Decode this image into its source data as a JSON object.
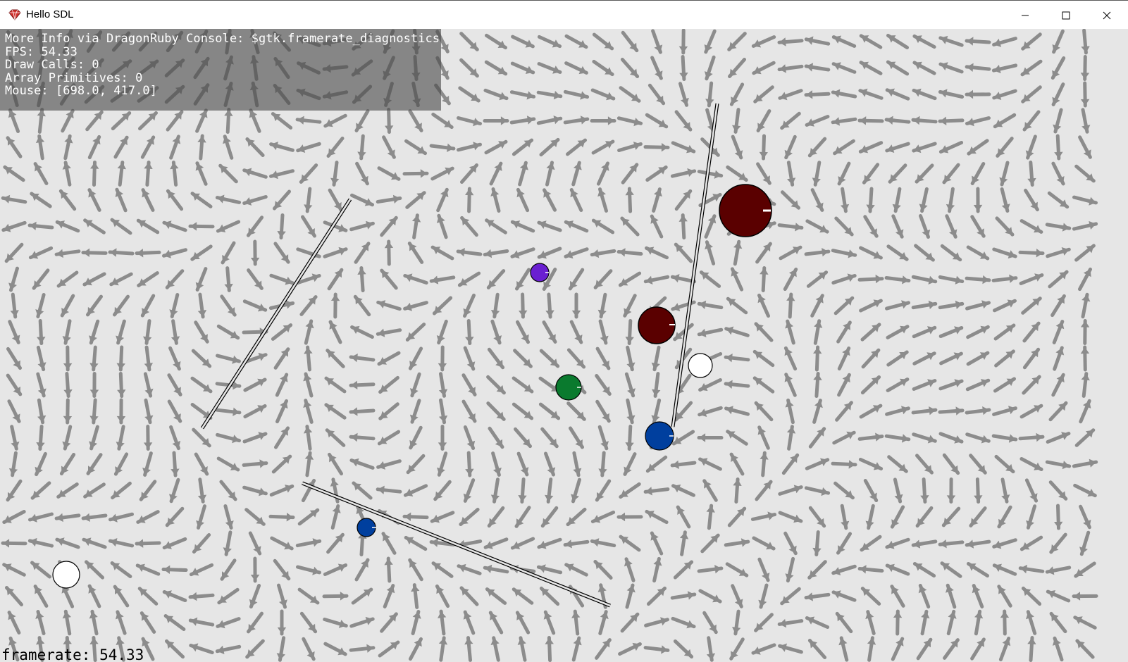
{
  "window": {
    "title": "Hello SDL",
    "controls": {
      "minimize": "minimize-icon",
      "maximize": "maximize-icon",
      "close": "close-icon"
    }
  },
  "diagnostics": {
    "line1": "More Info via DragonRuby Console: $gtk.framerate_diagnostics",
    "line2": "FPS: 54.33",
    "line3": "Draw Calls: 0",
    "line4": "Array Primitives: 0",
    "line5": "Mouse: [698.0, 417.0]"
  },
  "footer": {
    "framerate": "framerate: 54.33"
  },
  "colors": {
    "background": "#e6e6e6",
    "arrow": "#8c8c8c",
    "ball_dark_red": "#5a0000",
    "ball_purple": "#6a1fd1",
    "ball_green": "#0a7a2e",
    "ball_blue": "#003f9e",
    "ball_white": "#ffffff"
  }
}
